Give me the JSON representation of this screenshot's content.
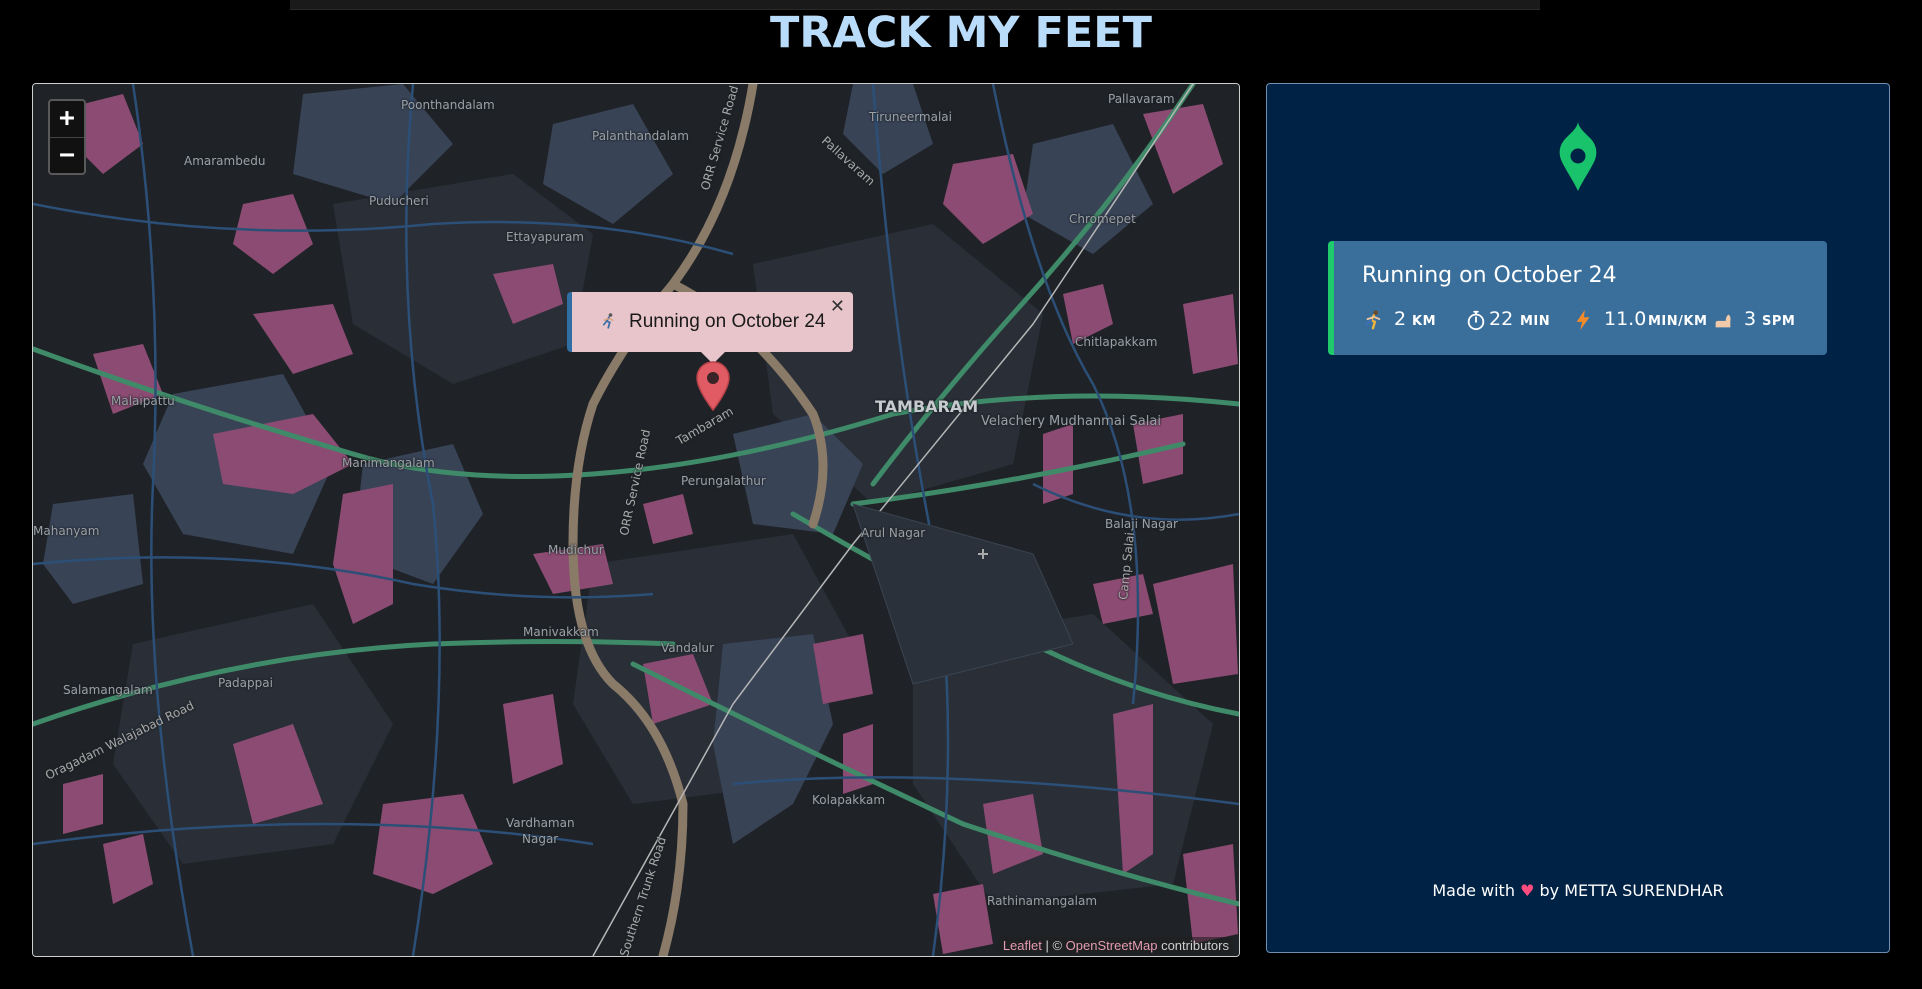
{
  "app": {
    "title": "TRACK MY FEET"
  },
  "map": {
    "zoom_in": "+",
    "zoom_out": "−",
    "popup": {
      "text": "Running on October 24",
      "close": "✕",
      "icon": "running-icon"
    },
    "attribution": {
      "leaflet": "Leaflet",
      "sep": " | © ",
      "osm": "OpenStreetMap",
      "suffix": " contributors"
    },
    "labels": {
      "poonthandalam": "Poonthandalam",
      "pallavaram_top": "Pallavaram",
      "tiruneermalai": "Tiruneermalai",
      "amarambedu": "Amarambedu",
      "palanthandalam": "Palanthandalam",
      "pallavaram": "Pallavaram",
      "puducheri": "Puducheri",
      "chromepet": "Chromepet",
      "ettayapuram": "Ettayapuram",
      "orr_road_top": "ORR Service Road",
      "chitlapakkam": "Chitlapakkam",
      "malaipattu": "Malaipattu",
      "tambaram": "TAMBARAM",
      "velachery": "Velachery Mudhanmai Salai",
      "tambaram_road": "Tambaram",
      "manimangalam": "Manimangalam",
      "orr_road_mid": "ORR Service Road",
      "perungalathur": "Perungalathur",
      "mahanyam": "Mahanyam",
      "arul_nagar": "Arul Nagar",
      "balaji_nagar": "Balaji Nagar",
      "mudichur": "Mudichur",
      "camp_salai": "Camp Salai",
      "manivakkam": "Manivakkam",
      "vandalur": "Vandalur",
      "padappai": "Padappai",
      "salamangalam": "Salamangalam",
      "walajabad": "Oragadam Walajabad Road",
      "kolapakkam": "Kolapakkam",
      "vardhaman": "Vardhaman",
      "nagar": "Nagar",
      "rathinamangalam": "Rathinamangalam",
      "gst": "Southern Trunk Road"
    }
  },
  "sidebar": {
    "logo_icon": "map-pin-icon",
    "workout": {
      "title": "Running on October 24",
      "stats": [
        {
          "icon": "running-icon",
          "value": "2",
          "unit": "KM"
        },
        {
          "icon": "stopwatch-icon",
          "value": "22",
          "unit": "MIN"
        },
        {
          "icon": "lightning-icon",
          "value": "11.0",
          "unit": "MIN/KM"
        },
        {
          "icon": "foot-icon",
          "value": "3",
          "unit": "SPM"
        }
      ]
    },
    "footer": {
      "prefix": "Made with ",
      "heart": "♥",
      "suffix": " by METTA SURENDHAR"
    }
  },
  "colors": {
    "title": "#b9dcfb",
    "sidebar_bg": "#002244",
    "card_bg": "#3a6f9c",
    "card_accent": "#20c96b",
    "popup_bg": "#e8c4cb",
    "popup_accent": "#2f6da3",
    "marker": "#e05b63"
  }
}
